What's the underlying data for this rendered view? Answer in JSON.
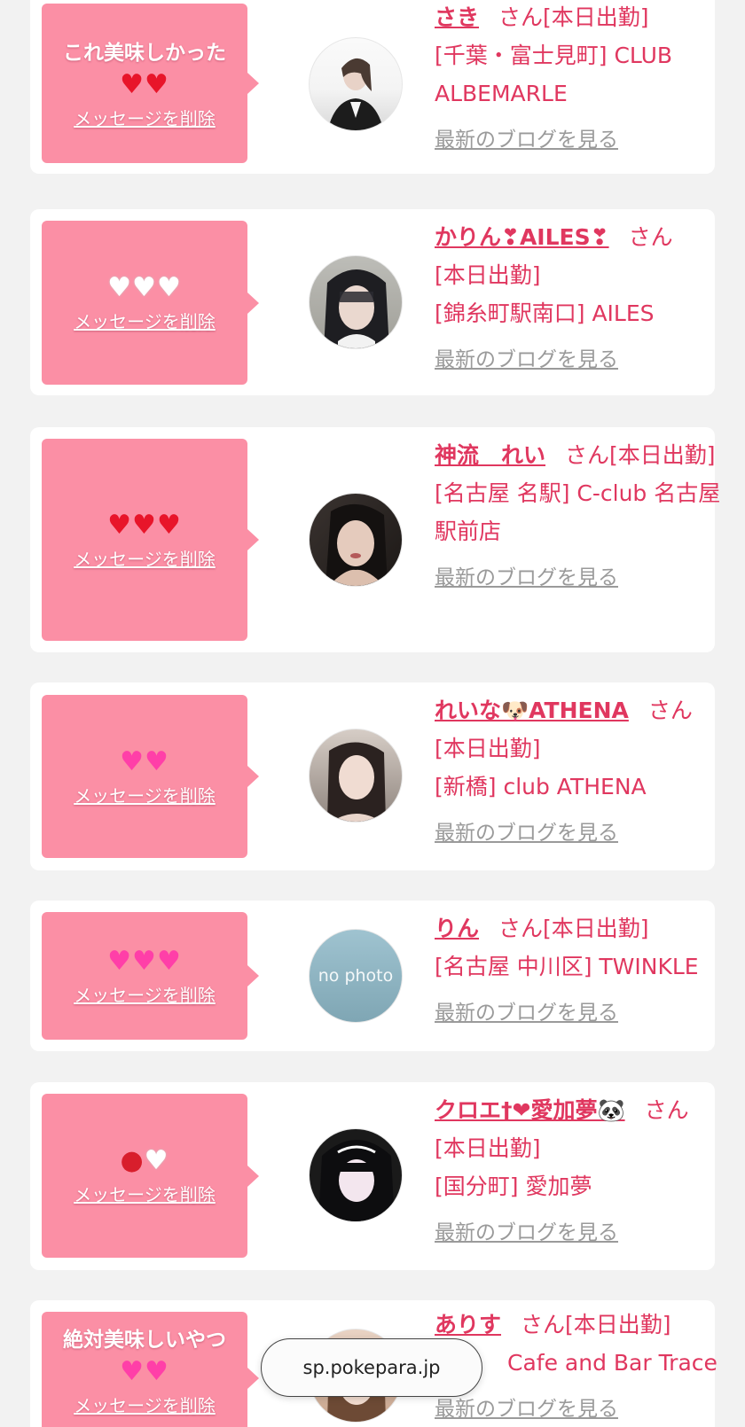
{
  "address_bar": {
    "url": "sp.pokepara.jp"
  },
  "delete_label": "メッセージを削除",
  "blog_label": "最新のブログを見る",
  "san_label": "さん",
  "items": [
    {
      "message": "これ美味しかった",
      "icons": [
        "heart-red",
        "heart-red"
      ],
      "name": "さき",
      "status": "[本日出勤]",
      "area": "[千葉・富士見町] CLUB ALBEMARLE"
    },
    {
      "message": "",
      "icons": [
        "heart-white",
        "heart-white",
        "heart-white"
      ],
      "name": "かりん❣AILES❣",
      "status": "[本日出勤]",
      "area": "[錦糸町駅南口] AILES"
    },
    {
      "message": "",
      "icons": [
        "heart-red",
        "heart-red",
        "heart-red"
      ],
      "name": "神流　れい",
      "status": "[本日出勤]",
      "area": "[名古屋 名駅] C-club 名古屋駅前店"
    },
    {
      "message": "",
      "icons": [
        "sparkling-heart",
        "sparkling-heart"
      ],
      "name": "れいな🐶ATHENA",
      "status": "[本日出勤]",
      "area": "[新橋] club ATHENA"
    },
    {
      "message": "",
      "icons": [
        "sparkling-heart",
        "sparkling-heart",
        "sparkling-heart"
      ],
      "name": "りん",
      "status": "[本日出勤]",
      "area": "[名古屋 中川区] TWINKLE",
      "avatar_text": "no photo"
    },
    {
      "message": "",
      "icons": [
        "strawberry",
        "heart-white"
      ],
      "name": "クロエ†❤愛加夢🐼",
      "status": "[本日出勤]",
      "area": "[国分町] 愛加夢"
    },
    {
      "message": "絶対美味しいやつ",
      "icons": [
        "sparkling-heart",
        "sparkling-heart"
      ],
      "name": "ありす",
      "status": "[本日出勤]",
      "area": "Cafe and Bar Trace"
    }
  ]
}
